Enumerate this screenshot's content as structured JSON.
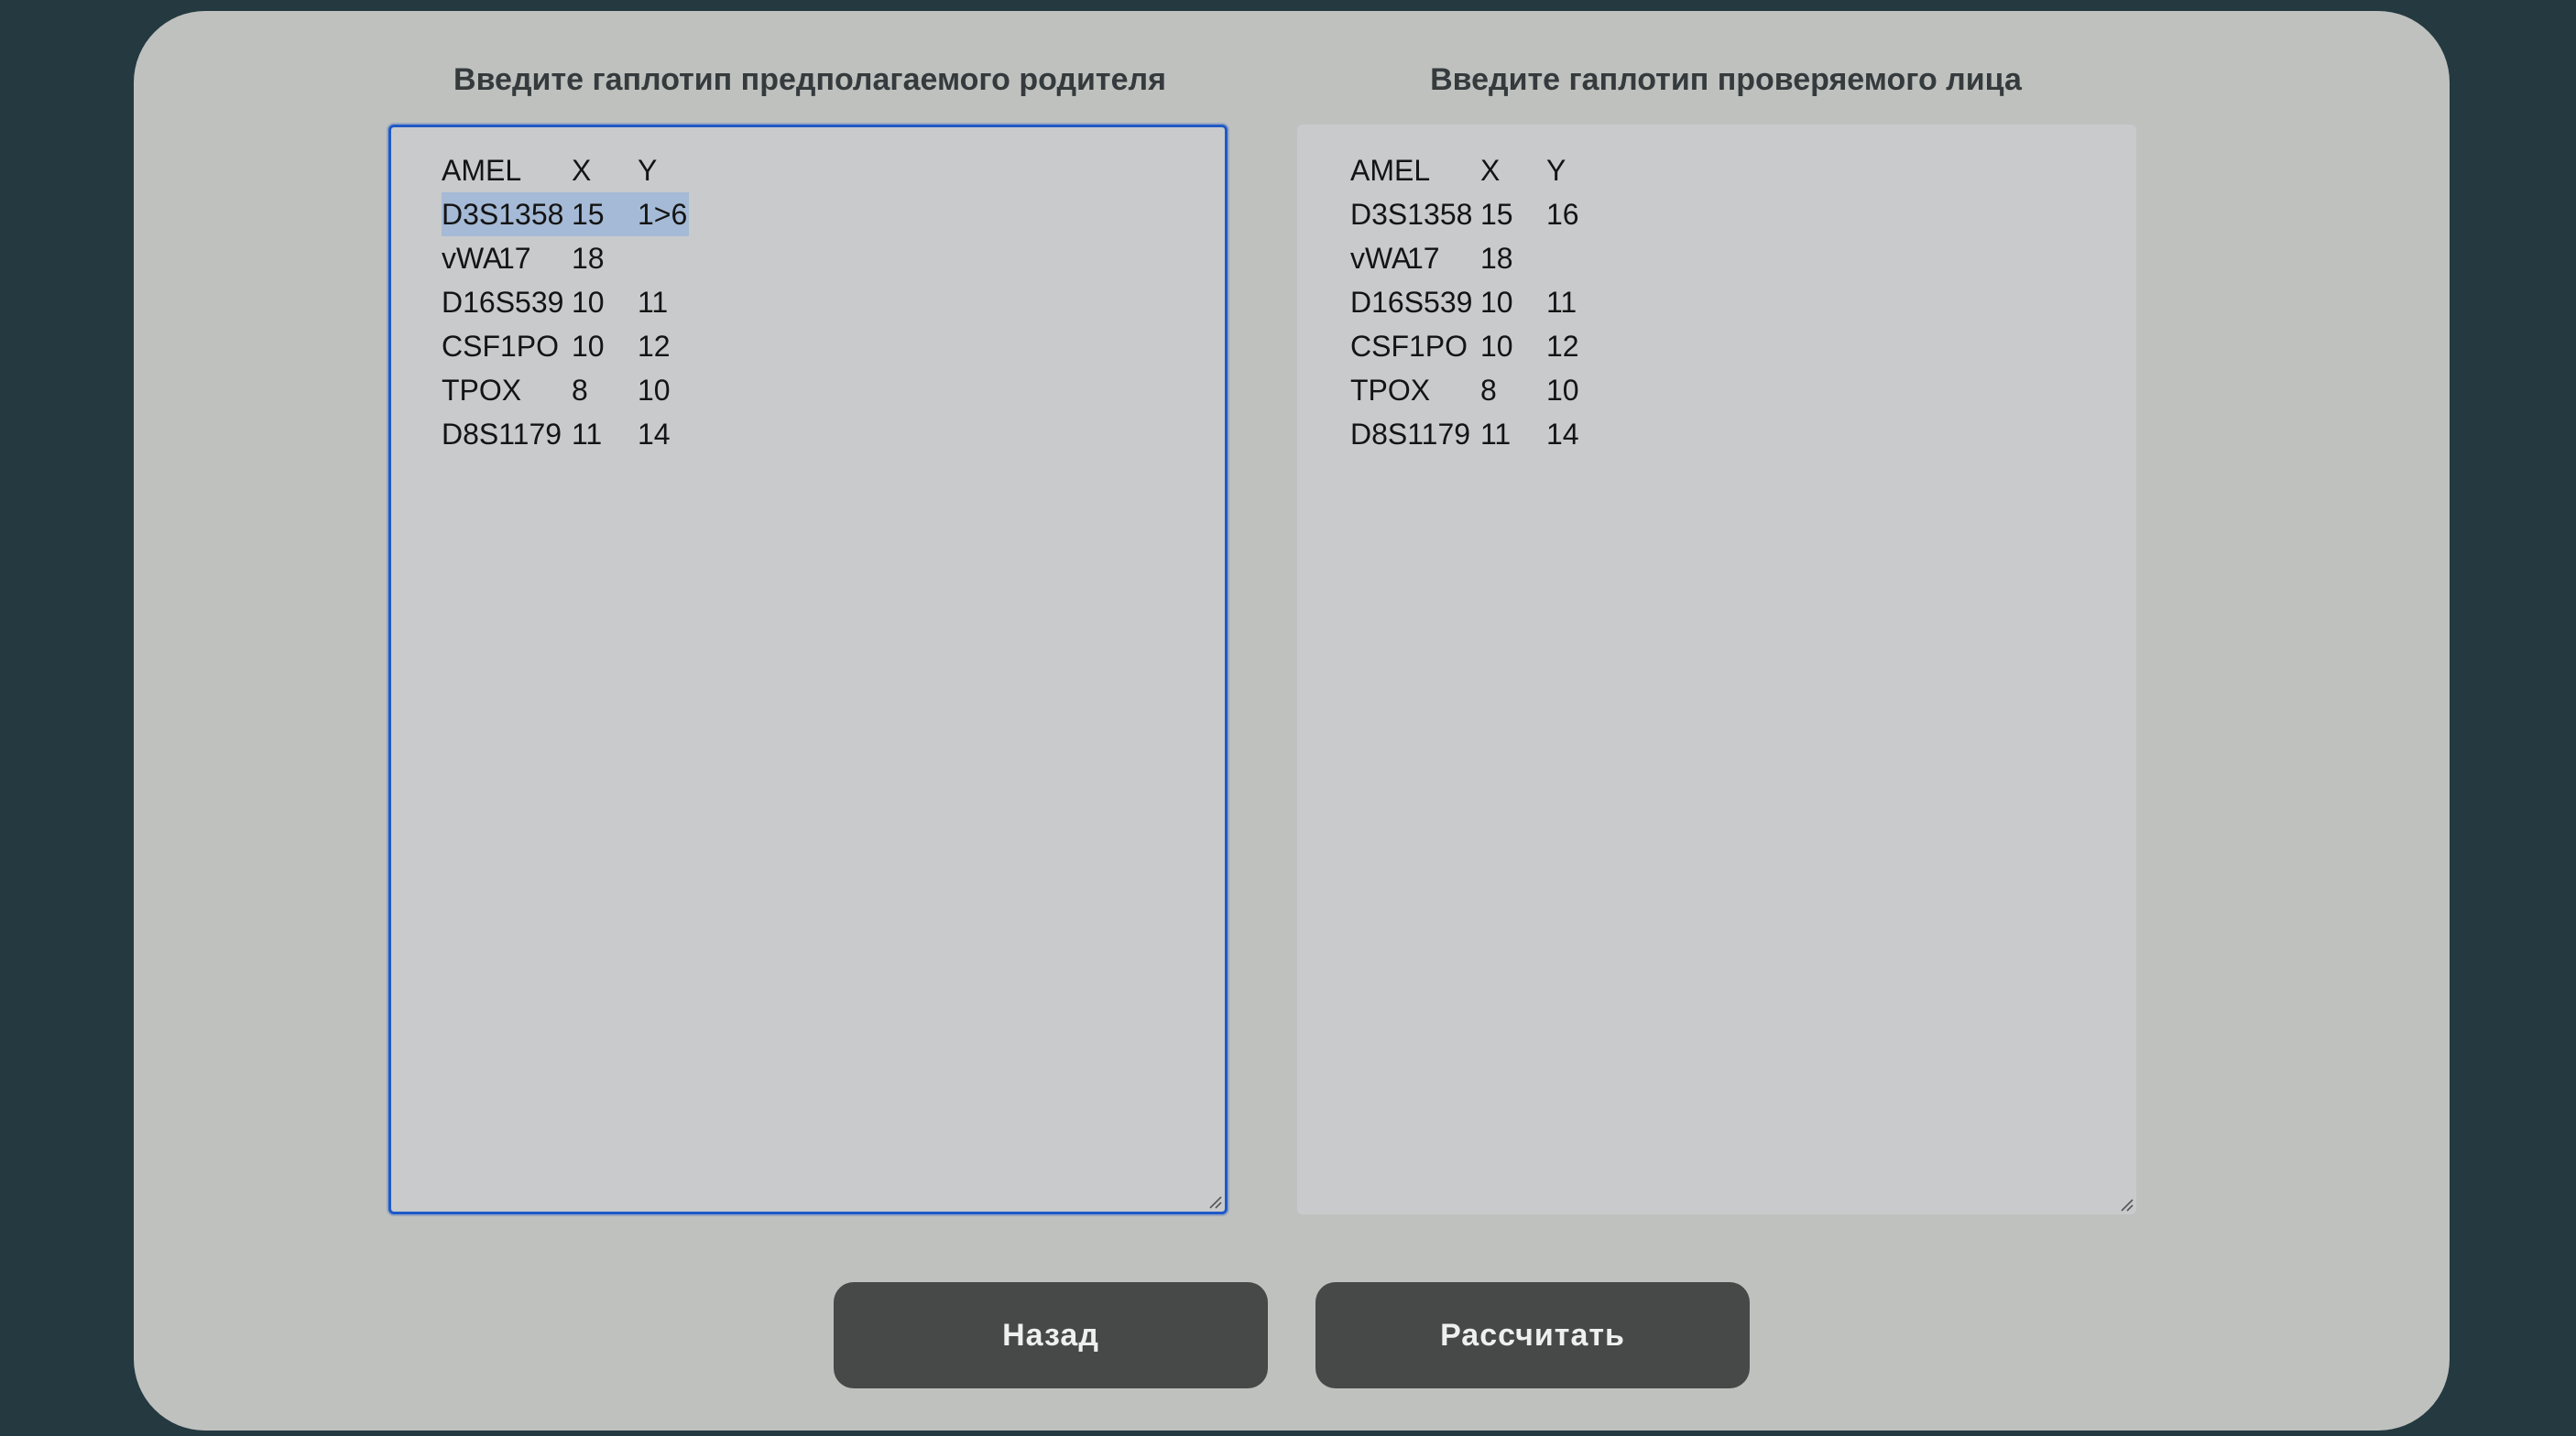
{
  "parent_panel": {
    "title": "Введите гаплотип предполагаемого родителя",
    "rows": [
      {
        "locus": "AMEL",
        "a": "X",
        "b": "Y"
      },
      {
        "locus": "D3S1358",
        "a": "15",
        "b": "1>6"
      },
      {
        "locus": "vWA",
        "a": "17",
        "b": "18"
      },
      {
        "locus": "D16S539",
        "a": "10",
        "b": "11"
      },
      {
        "locus": "CSF1PO",
        "a": "10",
        "b": "12"
      },
      {
        "locus": "TPOX",
        "a": "8",
        "b": "10"
      },
      {
        "locus": "D8S1179",
        "a": "11",
        "b": "14"
      }
    ],
    "selected_row_index": 1
  },
  "subject_panel": {
    "title": "Введите гаплотип проверяемого лица",
    "rows": [
      {
        "locus": "AMEL",
        "a": "X",
        "b": "Y"
      },
      {
        "locus": "D3S1358",
        "a": "15",
        "b": "16"
      },
      {
        "locus": "vWA",
        "a": "17",
        "b": "18"
      },
      {
        "locus": "D16S539",
        "a": "10",
        "b": "11"
      },
      {
        "locus": "CSF1PO",
        "a": "10",
        "b": "12"
      },
      {
        "locus": "TPOX",
        "a": "8",
        "b": "10"
      },
      {
        "locus": "D8S1179",
        "a": "11",
        "b": "14"
      }
    ]
  },
  "buttons": {
    "back_label": "Назад",
    "calculate_label": "Рассчитать"
  },
  "colors": {
    "page_background": "#243940",
    "card_background": "#bfc1bf",
    "textarea_background": "#c9cacc",
    "focus_border": "#1f59c6",
    "selection": "#a5bad6",
    "button_background": "#474948",
    "button_text": "#eef0ef"
  },
  "icons": {
    "resize_handle": "resize-grip-icon"
  }
}
